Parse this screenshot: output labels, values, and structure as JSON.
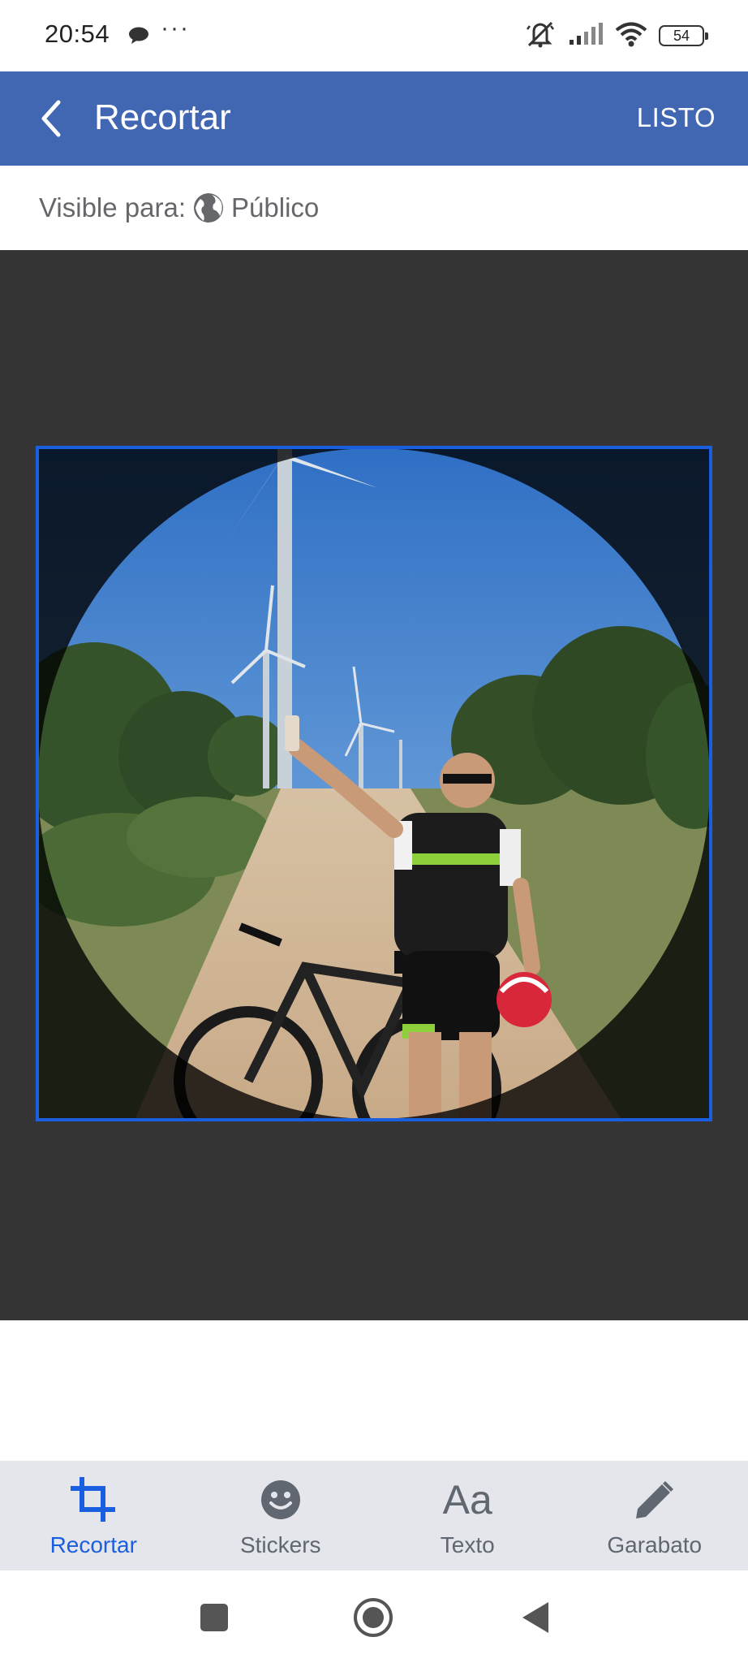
{
  "status_bar": {
    "time": "20:54",
    "more": "···",
    "battery": "54",
    "icons": [
      "chat-bubble-icon",
      "mute-icon",
      "signal-icon",
      "wifi-icon",
      "battery-icon"
    ]
  },
  "app_bar": {
    "title": "Recortar",
    "done_label": "LISTO",
    "background": "#4267b2"
  },
  "visibility": {
    "label": "Visible para:",
    "audience": "Público",
    "icon": "globe-icon"
  },
  "editor": {
    "background": "#353535",
    "crop_frame_color": "#1a5fe0"
  },
  "toolbar": {
    "tools": [
      {
        "label": "Recortar",
        "icon": "crop-icon",
        "active": true
      },
      {
        "label": "Stickers",
        "icon": "smiley-icon",
        "active": false
      },
      {
        "label": "Texto",
        "icon": "text-aa-icon",
        "glyph": "Aa",
        "active": false
      },
      {
        "label": "Garabato",
        "icon": "pencil-icon",
        "active": false
      }
    ],
    "active_color": "#1a5fe0"
  },
  "nav_bar": {
    "buttons": [
      "recents-square-icon",
      "home-circle-icon",
      "back-triangle-icon"
    ]
  }
}
